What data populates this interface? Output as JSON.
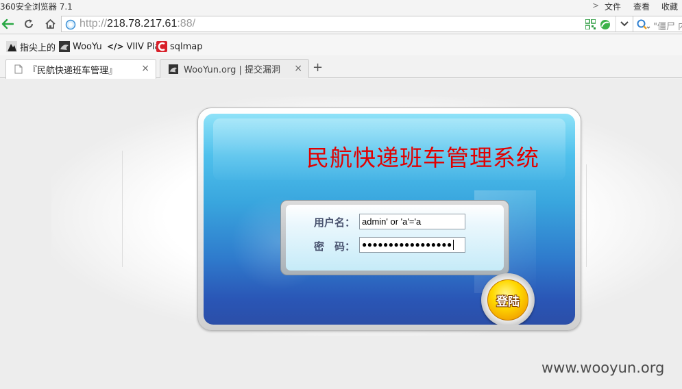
{
  "browser": {
    "app_title": "360安全浏览器 7.1",
    "menu": {
      "arrow": ">",
      "file": "文件",
      "view": "查看",
      "favorites": "收藏"
    },
    "address": {
      "proto": "http://",
      "host": "218.78.217.61",
      "rest": ":88/"
    },
    "search_hint": "\"僵尸 内"
  },
  "bookmarks": [
    {
      "label": "指尖上的",
      "icon": "black-white-photo-icon"
    },
    {
      "label": "WooYu",
      "icon": "wooyun-icon"
    },
    {
      "label": "VIIV Pla",
      "icon": "code-tag-icon",
      "glyph": "</>"
    },
    {
      "label": "sqlmap",
      "icon": "sqlmap-icon"
    }
  ],
  "tabs": [
    {
      "label": "『民航快递班车管理』",
      "active": true
    },
    {
      "label": "WooYun.org | 提交漏洞",
      "active": false
    }
  ],
  "new_tab": "+",
  "close_glyph": "×",
  "page": {
    "title": "民航快递班车管理系统",
    "username_label": "用户名：",
    "username_value": "admin' or 'a'='a",
    "password_label": "密　码：",
    "password_value": "●●●●●●●●●●●●●●●●●",
    "login_button": "登陆"
  },
  "watermark": "www.wooyun.org",
  "colors": {
    "title_red": "#e10000",
    "panel_blue": "#39a6de",
    "button_yellow": "#ffd800",
    "back_green": "#2aa845"
  }
}
